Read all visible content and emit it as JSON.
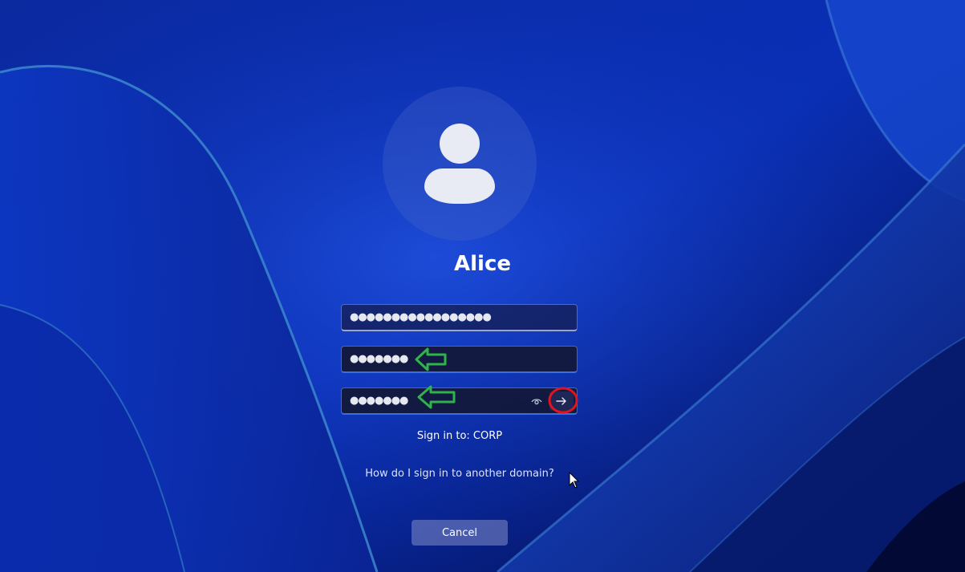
{
  "user": {
    "name": "Alice"
  },
  "fields": {
    "username_value": "●●●●●●●●●●●●●●●●●",
    "password_value": "●●●●●●●",
    "confirm_password_value": "●●●●●●●"
  },
  "icons": {
    "avatar": "user-avatar-icon",
    "reveal": "eye-icon",
    "submit": "arrow-right-icon",
    "annotation_arrow": "arrow-left-icon",
    "cursor": "mouse-pointer-icon"
  },
  "text": {
    "sign_in_to": "Sign in to: CORP",
    "other_domain": "How do I sign in to another domain?",
    "cancel": "Cancel"
  },
  "colors": {
    "annotation_arrow": "#2fb34a",
    "annotation_circle": "#e0141e",
    "focus_border": "#3a6ee8"
  }
}
